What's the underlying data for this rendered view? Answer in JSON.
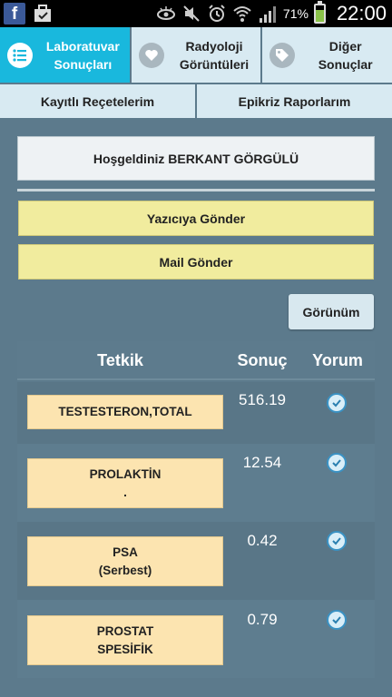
{
  "status_bar": {
    "facebook_icon_letter": "f",
    "battery_percent": "71%",
    "battery_level": 0.71,
    "time": "22:00",
    "icons": [
      "facebook-icon",
      "bag-icon",
      "eye-icon",
      "mute-icon",
      "alarm-icon",
      "wifi-icon",
      "signal-icon",
      "battery-icon"
    ]
  },
  "tabs": [
    {
      "label": "Laboratuvar\nSonuçları",
      "icon": "list-icon",
      "active": true
    },
    {
      "label": "Radyoloji\nGörüntüleri",
      "icon": "heart-icon",
      "active": false
    },
    {
      "label": "Diğer\nSonuçlar",
      "icon": "tag-icon",
      "active": false
    }
  ],
  "secondary_tabs": [
    {
      "label": "Kayıtlı Reçetelerim"
    },
    {
      "label": "Epikriz Raporlarım"
    }
  ],
  "welcome_text": "Hoşgeldiniz BERKANT GÖRGÜLÜ",
  "buttons": {
    "print": "Yazıcıya Gönder",
    "mail": "Mail Gönder",
    "view": "Görünüm"
  },
  "table": {
    "headers": {
      "test": "Tetkik",
      "result": "Sonuç",
      "comment": "Yorum"
    },
    "rows": [
      {
        "test": "TESTESTERON,TOTAL",
        "result": "516.19"
      },
      {
        "test": "PROLAKTİN\n.",
        "result": "12.54"
      },
      {
        "test": "PSA\n(Serbest)",
        "result": "0.42"
      },
      {
        "test": "PROSTAT\nSPESİFİK",
        "result": "0.79"
      }
    ]
  },
  "colors": {
    "accent": "#19b8dd",
    "background": "#5c7a8c",
    "button_yellow": "#f1ec9e",
    "test_box": "#fce4b0"
  }
}
